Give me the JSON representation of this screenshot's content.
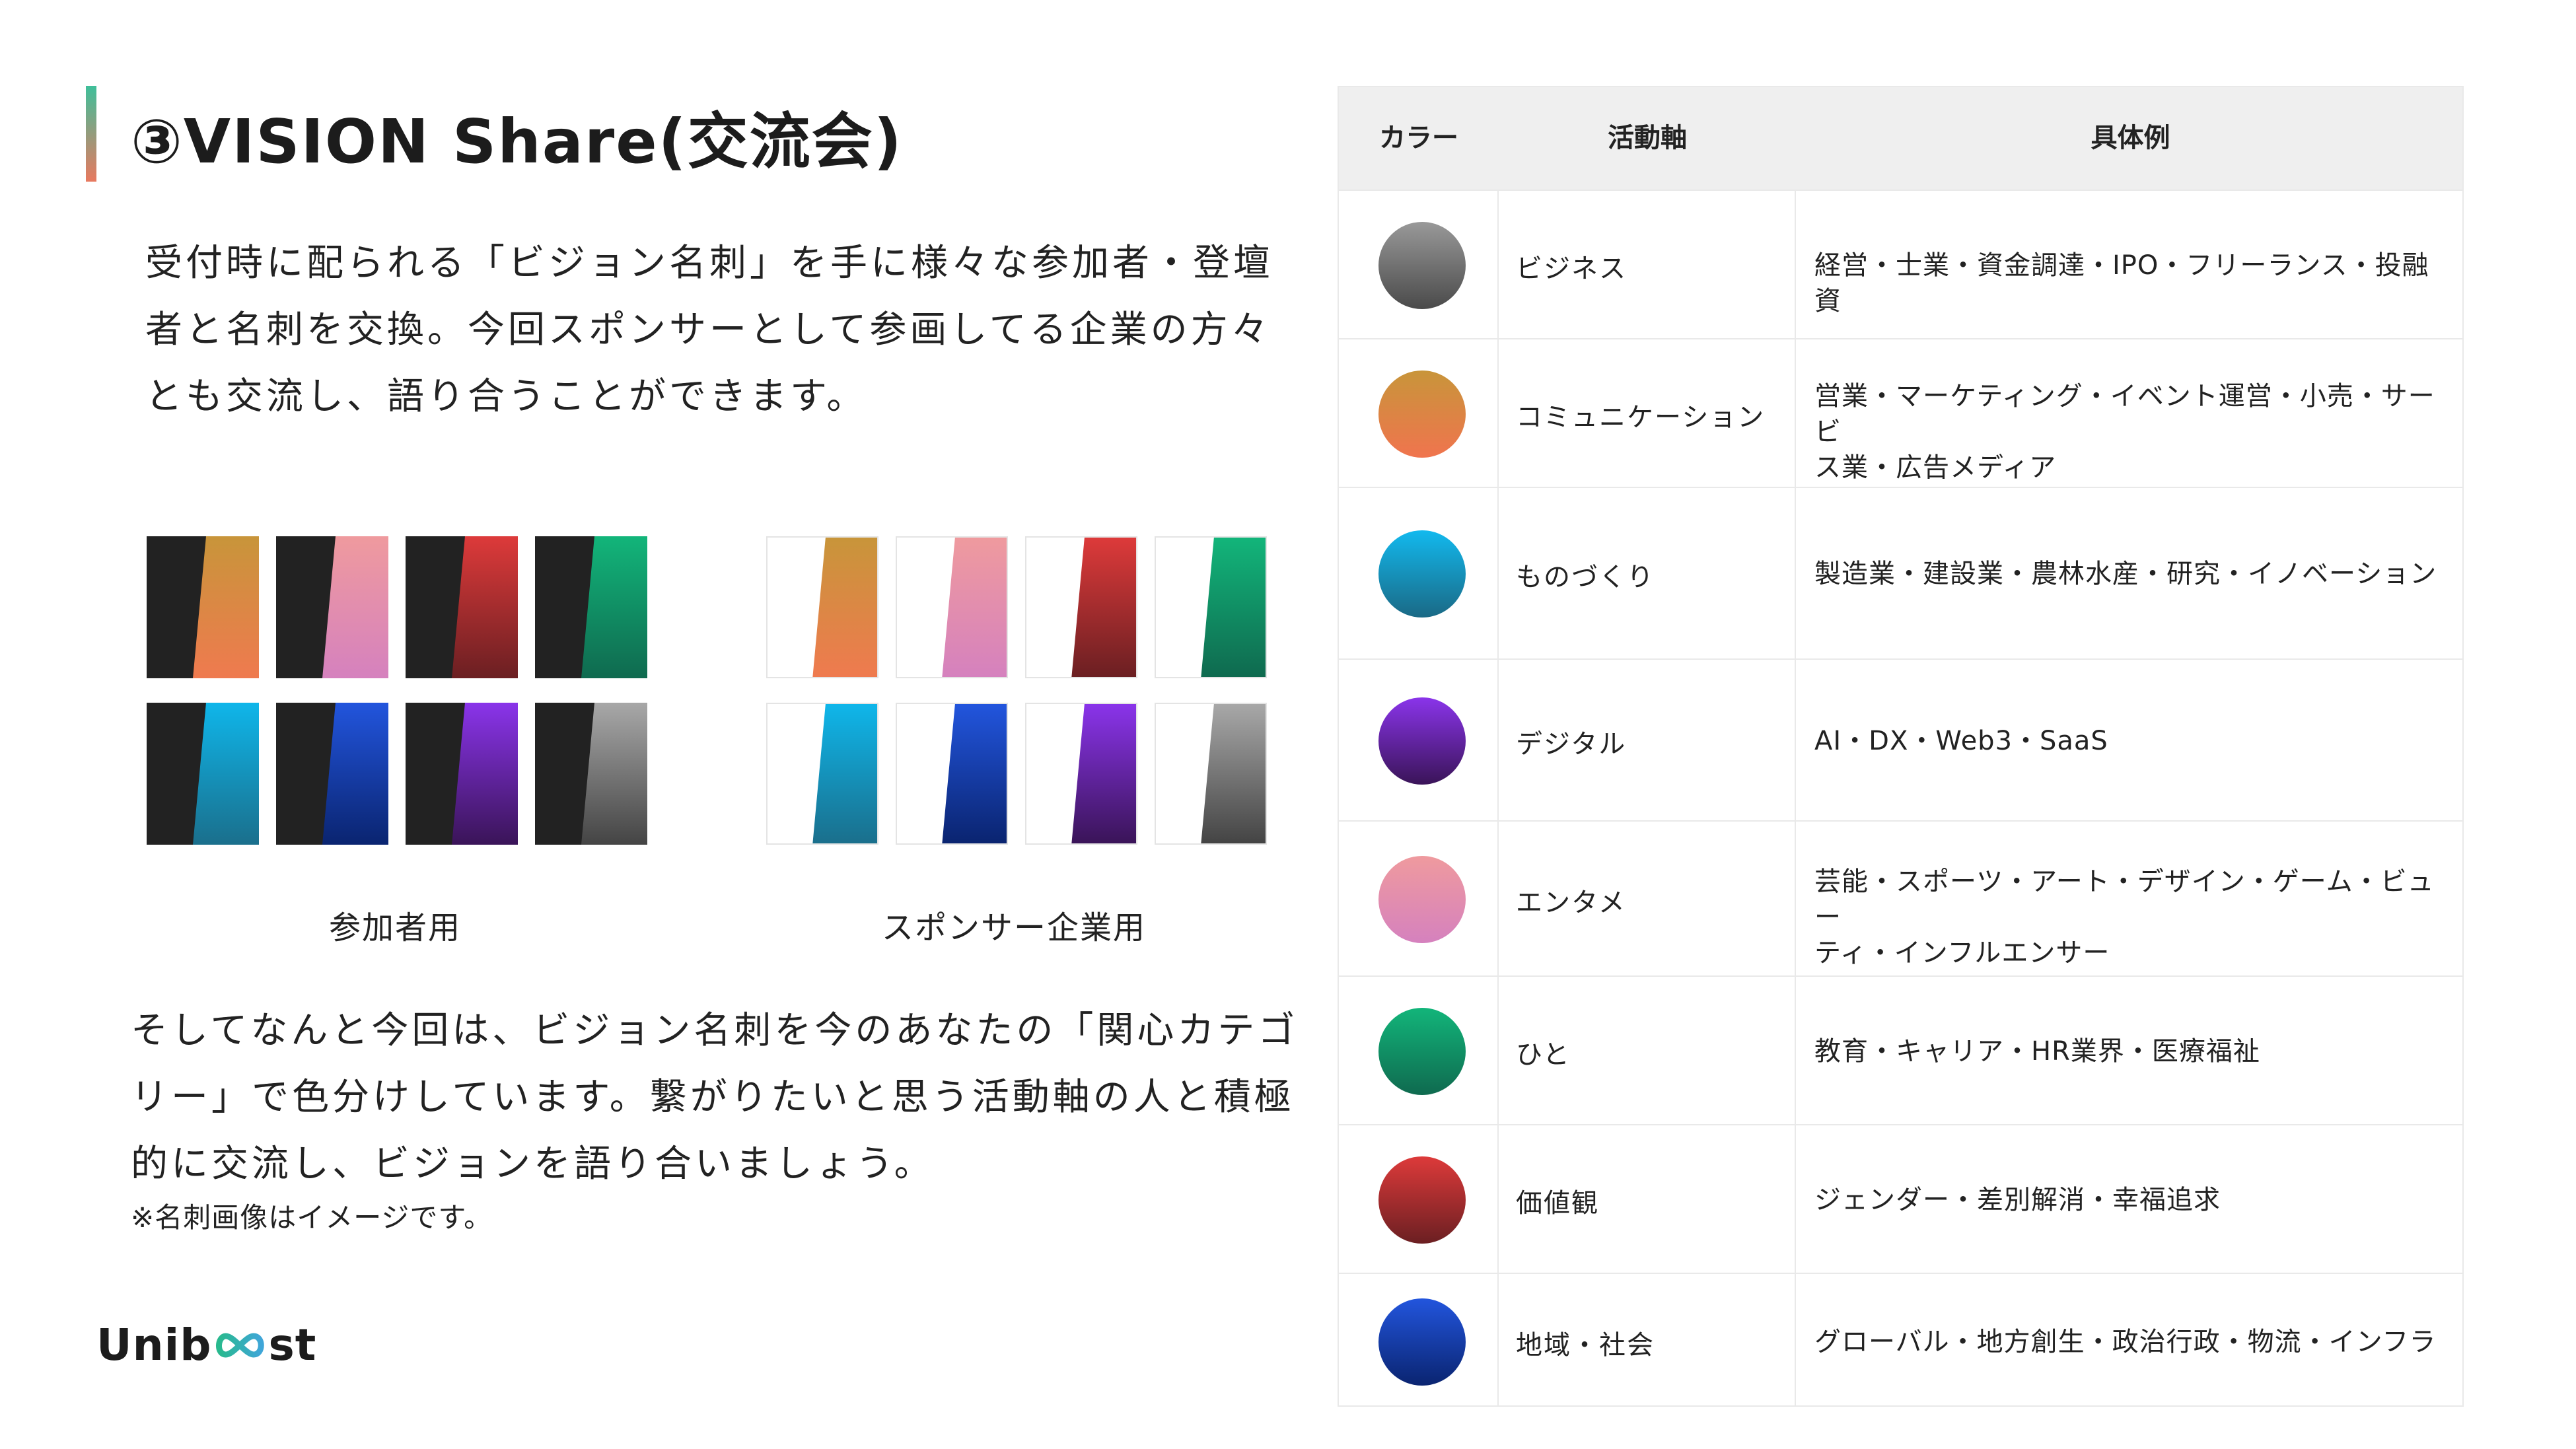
{
  "title": "③VISION Share(交流会)",
  "intro": [
    "受付時に配られる「ビジョン名刺」を手に様々な参加者・登壇",
    "者と名刺を交換。今回スポンサーとして参画してる企業の方々",
    "とも交流し、語り合うことができます。"
  ],
  "cards": {
    "participant_caption": "参加者用",
    "sponsor_caption": "スポンサー企業用",
    "colors": [
      {
        "name": "orange",
        "top": "#c8953a",
        "bottom": "#ef7a4f"
      },
      {
        "name": "pink",
        "top": "#ef9a9e",
        "bottom": "#d581be"
      },
      {
        "name": "red",
        "top": "#dd3a3a",
        "bottom": "#6b1f22"
      },
      {
        "name": "green",
        "top": "#12b57a",
        "bottom": "#0f6a4f"
      },
      {
        "name": "cyan",
        "top": "#0fb6ea",
        "bottom": "#1a6f8c"
      },
      {
        "name": "blue",
        "top": "#2255dd",
        "bottom": "#0a2470"
      },
      {
        "name": "purple",
        "top": "#8a34ea",
        "bottom": "#3a1458"
      },
      {
        "name": "gray",
        "top": "#a8a8a8",
        "bottom": "#444444"
      }
    ]
  },
  "closing": [
    "そしてなんと今回は、ビジョン名刺を今のあなたの「関心カテゴ",
    "リー」で色分けしています。繋がりたいと思う活動軸の人と積極",
    "的に交流し、ビジョンを語り合いましょう。"
  ],
  "note": "※名刺画像はイメージです。",
  "logo": {
    "left": "Unib",
    "right": "st"
  },
  "table": {
    "headers": {
      "color": "カラー",
      "axis": "活動軸",
      "examples": "具体例"
    },
    "rows": [
      {
        "category": "ビジネス",
        "examples": [
          "経営・士業・資金調達・IPO・フリーランス・投融資"
        ],
        "top": "#999999",
        "bottom": "#4a4a4a"
      },
      {
        "category": "コミュニケーション",
        "examples": [
          "営業・マーケティング・イベント運営・小売・サービ",
          "ス業・広告メディア"
        ],
        "top": "#c8953a",
        "bottom": "#f0744e"
      },
      {
        "category": "ものづくり",
        "examples": [
          "製造業・建設業・農林水産・研究・イノベーション"
        ],
        "top": "#12b9ee",
        "bottom": "#1a6985"
      },
      {
        "category": "デジタル",
        "examples": [
          "AI・DX・Web3・SaaS"
        ],
        "top": "#8a34ea",
        "bottom": "#3a1458"
      },
      {
        "category": "エンタメ",
        "examples": [
          "芸能・スポーツ・アート・デザイン・ゲーム・ビュー",
          "ティ・インフルエンサー"
        ],
        "top": "#ef9a9e",
        "bottom": "#d581be"
      },
      {
        "category": "ひと",
        "examples": [
          "教育・キャリア・HR業界・医療福祉"
        ],
        "top": "#12b57a",
        "bottom": "#0f6a4f"
      },
      {
        "category": "価値観",
        "examples": [
          "ジェンダー・差別解消・幸福追求"
        ],
        "top": "#dd3a3a",
        "bottom": "#6b1f22"
      },
      {
        "category": "地域・社会",
        "examples": [
          "グローバル・地方創生・政治行政・物流・インフラ"
        ],
        "top": "#2255dd",
        "bottom": "#0a2470"
      }
    ]
  }
}
